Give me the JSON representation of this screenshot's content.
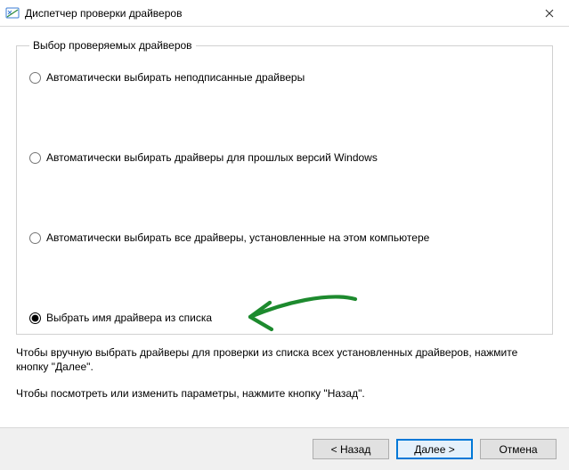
{
  "window": {
    "title": "Диспетчер проверки драйверов"
  },
  "group": {
    "legend": "Выбор проверяемых драйверов",
    "options": [
      "Автоматически выбирать неподписанные драйверы",
      "Автоматически выбирать драйверы для прошлых версий Windows",
      "Автоматически выбирать все драйверы, установленные на этом компьютере",
      "Выбрать имя драйвера из списка"
    ],
    "selected_index": 3
  },
  "help": {
    "p1": "Чтобы вручную выбрать драйверы для проверки из списка всех установленных драйверов, нажмите кнопку \"Далее\".",
    "p2": "Чтобы посмотреть или изменить параметры, нажмите кнопку \"Назад\"."
  },
  "buttons": {
    "back": "< Назад",
    "next": "Далее >",
    "cancel": "Отмена"
  }
}
